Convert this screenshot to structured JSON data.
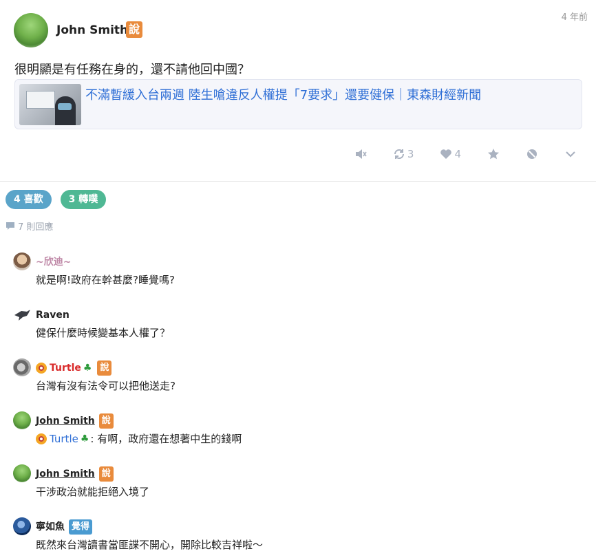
{
  "post": {
    "author": "John Smith",
    "qualifier": "說",
    "time": "4 年前",
    "content": "很明顯是有任務在身的，還不請他回中國？",
    "link_title": "不滿暫緩入台兩週 陸生嗆違反人權提「7要求」還要健保｜東森財經新聞",
    "actions": {
      "mute_icon": "mute-icon",
      "replurk_count": "3",
      "like_count": "4",
      "bookmark_icon": "star-icon",
      "block_icon": "block-icon",
      "more_icon": "chevron-down-icon"
    }
  },
  "stats": {
    "likes_label": "4 喜歡",
    "replurks_label": "3 轉噗",
    "reply_count": "7 則回應"
  },
  "colors": {
    "qualifier_says": "#e98b3c",
    "qualifier_feels": "#4a9bd1",
    "likes_pill": "#5aa4c9",
    "replurks_pill": "#4fb894",
    "link": "#2f6fd6"
  },
  "responses": [
    {
      "name": "~欣迪~",
      "qualifier": "",
      "text": "就是啊!政府在幹甚麼?睡覺嗎?"
    },
    {
      "name": "Raven",
      "qualifier": "",
      "text": "健保什麼時候變基本人權了？"
    },
    {
      "name": "Turtle",
      "qualifier": "說",
      "text": "台灣有沒有法令可以把他送走?"
    },
    {
      "name": "John Smith",
      "qualifier": "說",
      "mention": "Turtle",
      "text": ": 有啊，政府還在想著中生的錢啊"
    },
    {
      "name": "John Smith",
      "qualifier": "說",
      "text": "干涉政治就能拒絕入境了"
    },
    {
      "name": "寧如魚",
      "qualifier": "覺得",
      "text": "既然來台灣讀書當匪諜不開心，開除比較吉祥啦～"
    }
  ]
}
